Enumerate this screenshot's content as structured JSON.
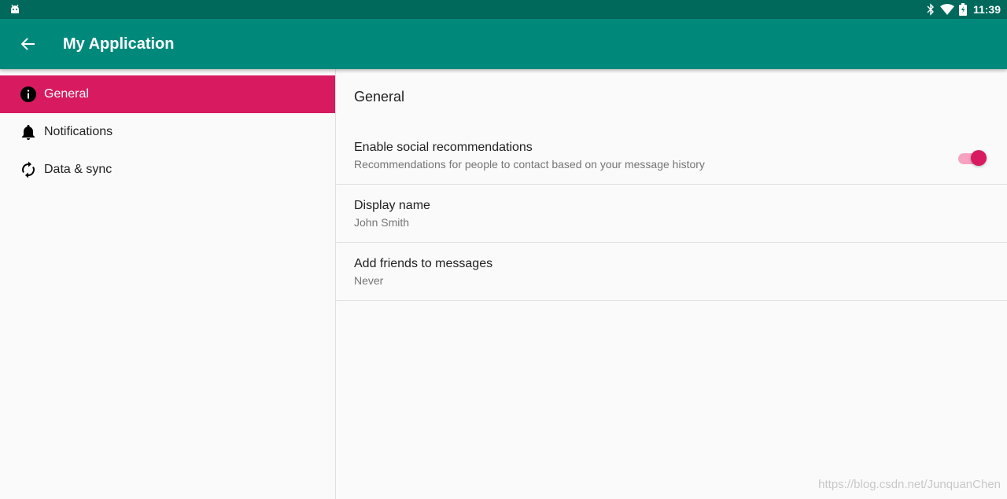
{
  "status_bar": {
    "time": "11:39",
    "icons": [
      "android-icon",
      "bluetooth-icon",
      "wifi-icon",
      "battery-icon"
    ]
  },
  "app_bar": {
    "title": "My Application",
    "back_icon": "arrow-back-icon",
    "color": "#00897b"
  },
  "sidebar": {
    "items": [
      {
        "label": "General",
        "icon": "info-icon",
        "selected": true
      },
      {
        "label": "Notifications",
        "icon": "bell-icon",
        "selected": false
      },
      {
        "label": "Data & sync",
        "icon": "sync-icon",
        "selected": false
      }
    ],
    "accent_color": "#d81b60"
  },
  "content": {
    "section_title": "General",
    "preferences": [
      {
        "title": "Enable social recommendations",
        "summary": "Recommendations for people to contact based on your message history",
        "switch_on": true
      },
      {
        "title": "Display name",
        "summary": "John Smith"
      },
      {
        "title": "Add friends to messages",
        "summary": "Never"
      }
    ]
  },
  "watermark": "https://blog.csdn.net/JunquanChen"
}
